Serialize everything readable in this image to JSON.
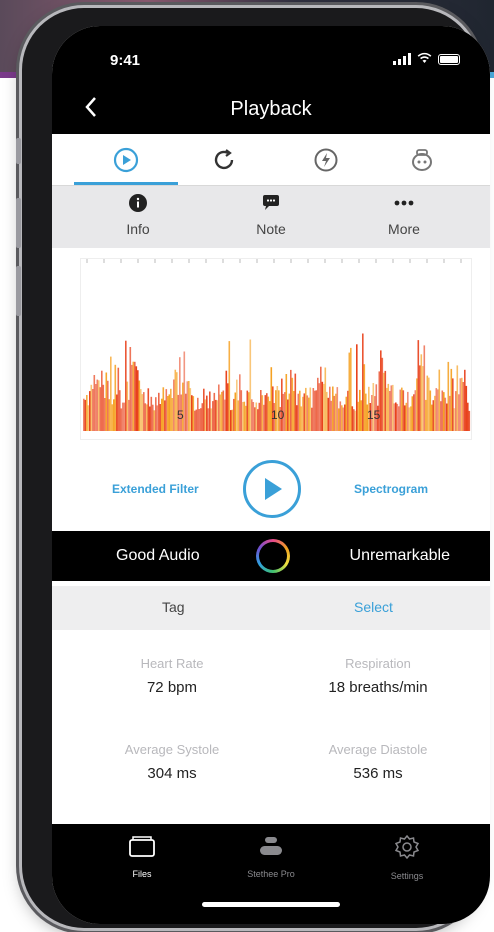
{
  "status": {
    "time": "9:41"
  },
  "nav": {
    "back_icon": "chevron-left",
    "title": "Playback"
  },
  "tabs": [
    {
      "name": "play",
      "icon": "play-circle-icon",
      "active": true
    },
    {
      "name": "loop",
      "icon": "loop-icon",
      "active": false
    },
    {
      "name": "bolt",
      "icon": "lightning-icon",
      "active": false
    },
    {
      "name": "stethoscope",
      "icon": "stethoscope-icon",
      "active": false
    }
  ],
  "actions": [
    {
      "label": "Info",
      "icon": "info-icon"
    },
    {
      "label": "Note",
      "icon": "chat-bubble-icon"
    },
    {
      "label": "More",
      "icon": "more-dots-icon"
    }
  ],
  "spectrogram": {
    "ticks": [
      "5",
      "10",
      "15"
    ]
  },
  "controls": {
    "left_label": "Extended Filter",
    "right_label": "Spectrogram"
  },
  "summary": {
    "left": "Good Audio",
    "right": "Unremarkable"
  },
  "tag": {
    "label": "Tag",
    "action": "Select"
  },
  "metrics": [
    {
      "label": "Heart Rate",
      "value": "72 bpm"
    },
    {
      "label": "Respiration",
      "value": "18 breaths/min"
    },
    {
      "label": "Average Systole",
      "value": "304 ms"
    },
    {
      "label": "Average Diastole",
      "value": "536 ms"
    }
  ],
  "tabbar": [
    {
      "label": "Files",
      "icon": "files-icon",
      "active": true
    },
    {
      "label": "Stethee Pro",
      "icon": "stethee-pro-icon",
      "active": false
    },
    {
      "label": "Settings",
      "icon": "gear-icon",
      "active": false
    }
  ],
  "colors": {
    "accent": "#3aa0d8",
    "spectrogram_hot": "#e8401a",
    "spectrogram_warm": "#f5a020"
  }
}
